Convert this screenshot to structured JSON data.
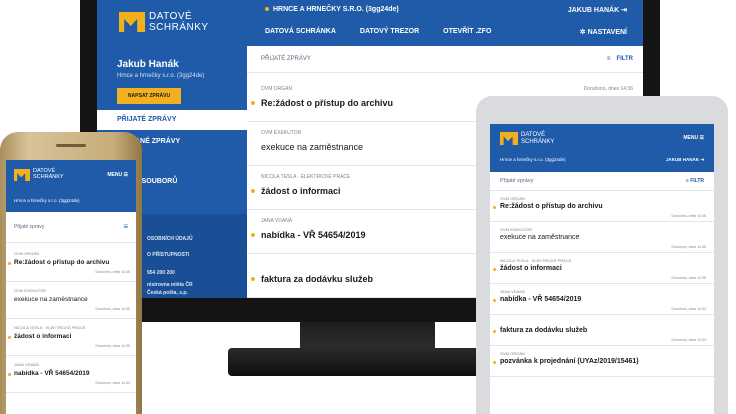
{
  "brand": {
    "logo_line1": "DATOVÉ",
    "logo_line2": "SCHRÁNKY",
    "accent": "#f2b01e",
    "primary": "#1f5ba8"
  },
  "desktop": {
    "header_org": "HRNCE A HRNEČKY S.R.O. (3gg24de)",
    "header_user": "JAKUB HANÁK",
    "nav": [
      "DATOVÁ SCHRÁNKA",
      "DATOVÝ TREZOR",
      "OTEVŘÍT .ZFO"
    ],
    "settings": "NASTAVENÍ",
    "sidebar": {
      "name": "Jakub Hanák",
      "company": "Hrnce a hrnečky s.r.o. (3gg24de)",
      "compose": "NAPSAT ZPRÁVU",
      "active": "PŘIJATÉ ZPRÁVY",
      "items": [
        "ANÉ ZPRÁVY",
        "E",
        "É SOUBORŮ"
      ],
      "footer": [
        "OSOBNÍCH ÚDAJŮ",
        "O PŘÍSTUPNOSTI",
        "954 200 200",
        "nistrovna mléta ČR",
        "Česká pošta, s.p."
      ]
    },
    "main_title": "PŘIJATÉ ZPRÁVY",
    "filter": "FILTR",
    "messages": [
      {
        "sender": "OVM ORGÁN",
        "date": "Doručeno, dnes 14:36",
        "subject": "Re:žádost o přístup do archivu",
        "unread": true
      },
      {
        "sender": "OVM EXEKUTOR",
        "date": "",
        "subject": "exekuce na zaměstnance",
        "unread": false
      },
      {
        "sender": "NICOLA TESLA · ELEKTRICKÉ PRÁCE",
        "date": "",
        "subject": "žádost o informaci",
        "unread": true
      },
      {
        "sender": "JANA VDANÁ",
        "date": "",
        "subject": "nabídka - VŘ 54654/2019",
        "unread": true
      },
      {
        "sender": "",
        "date": "",
        "subject": "faktura za dodávku služeb",
        "unread": true
      }
    ]
  },
  "tablet": {
    "menu": "MENU",
    "org": "Hrnce a hrnečky s.r.o. (3gg24de)",
    "user": "JAKUB HANÁK",
    "title": "Přijaté zprávy",
    "filter": "FILTR",
    "messages": [
      {
        "sender": "OVM ORGÁN",
        "subject": "Re:žádost o přístup do archivu",
        "date": "Doručeno, dnes 14:36",
        "unread": true
      },
      {
        "sender": "OVM EXEKUTOR",
        "subject": "exekuce na zaměstnance",
        "date": "Doručeno, dnes 14:35",
        "unread": false
      },
      {
        "sender": "NICOLA TESLA · ELEKTRICKÉ PRÁCE",
        "subject": "žádost o informaci",
        "date": "Doručeno, dnes 14:35",
        "unread": true
      },
      {
        "sender": "JANA VDANÁ",
        "subject": "nabídka - VŘ 54654/2019",
        "date": "Doručeno, dnes 14:34",
        "unread": true
      },
      {
        "sender": "",
        "subject": "faktura za dodávku služeb",
        "date": "Doručeno, dnes 14:33",
        "unread": true
      },
      {
        "sender": "OVM ORGÁN",
        "subject": "pozvánka k projednání (UYAz/2019/15461)",
        "date": "",
        "unread": true
      }
    ]
  },
  "phone": {
    "menu": "MENU",
    "org": "Hrnce a hrnečky s.r.o. (3gg24de)",
    "title": "Přijaté zprávy",
    "messages": [
      {
        "sender": "OVM ORGÁN",
        "subject": "Re:žádost o přístup do archivu",
        "date": "Doručeno, dnes 14:36",
        "unread": true
      },
      {
        "sender": "OVM EXEKUTOR",
        "subject": "exekuce na zaměstnance",
        "date": "Doručeno, dnes 14:35",
        "unread": false
      },
      {
        "sender": "NICOLA TESLA · ELEKTRICKÉ PRÁCE",
        "subject": "žádost o informaci",
        "date": "Doručeno, dnes 14:35",
        "unread": true
      },
      {
        "sender": "JANA VDANÁ",
        "subject": "nabídka - VŘ 54654/2019",
        "date": "Doručeno, dnes 14:34",
        "unread": true
      }
    ]
  }
}
